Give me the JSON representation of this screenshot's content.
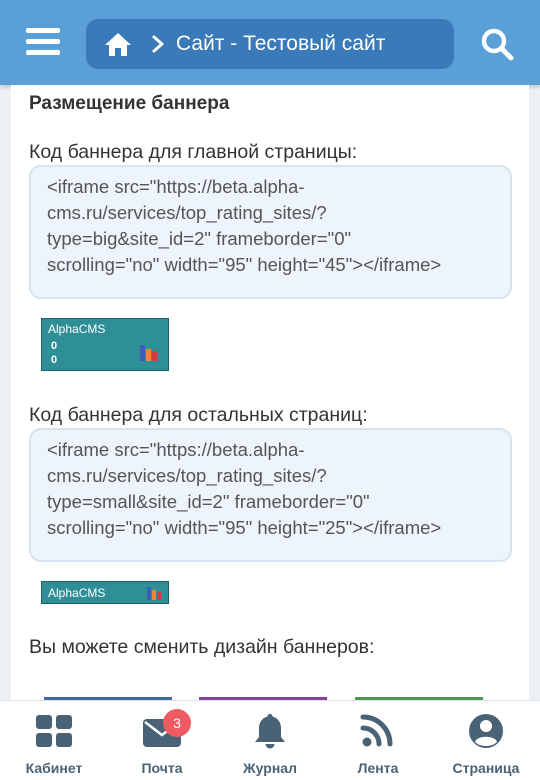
{
  "header": {
    "breadcrumb_text": "Сайт - Тестовый сайт",
    "bg_color": "#5a9fd8",
    "crumb_color": "#3a7ab8"
  },
  "main": {
    "title": "Размещение баннера",
    "main_banner_label": "Код баннера для главной страницы:",
    "main_banner_code": [
      "<iframe src=\"https://beta.alpha-",
      "cms.ru/services/top_rating_sites/?",
      "type=big&site_id=2\" frameborder=\"0\"",
      "scrolling=\"no\" width=\"95\" height=\"45\"></iframe>"
    ],
    "big_banner": {
      "name": "AlphaCMS",
      "value1": "0",
      "value2": "0"
    },
    "other_banner_label": "Код баннера для остальных страниц:",
    "other_banner_code": [
      "<iframe src=\"https://beta.alpha-",
      "cms.ru/services/top_rating_sites/?",
      "type=small&site_id=2\" frameborder=\"0\"",
      "scrolling=\"no\" width=\"95\" height=\"25\"></iframe>"
    ],
    "small_banner": {
      "name": "AlphaCMS"
    },
    "design_text": "Вы можете сменить дизайн баннеров:"
  },
  "tabbar": {
    "tabs": [
      {
        "label": "Кабинет",
        "icon": "grid-icon"
      },
      {
        "label": "Почта",
        "icon": "mail-icon",
        "badge": "3"
      },
      {
        "label": "Журнал",
        "icon": "bell-icon"
      },
      {
        "label": "Лента",
        "icon": "rss-icon"
      },
      {
        "label": "Страница",
        "icon": "user-icon"
      }
    ],
    "icon_color": "#4a6276",
    "badge_color": "#ef5b62"
  }
}
